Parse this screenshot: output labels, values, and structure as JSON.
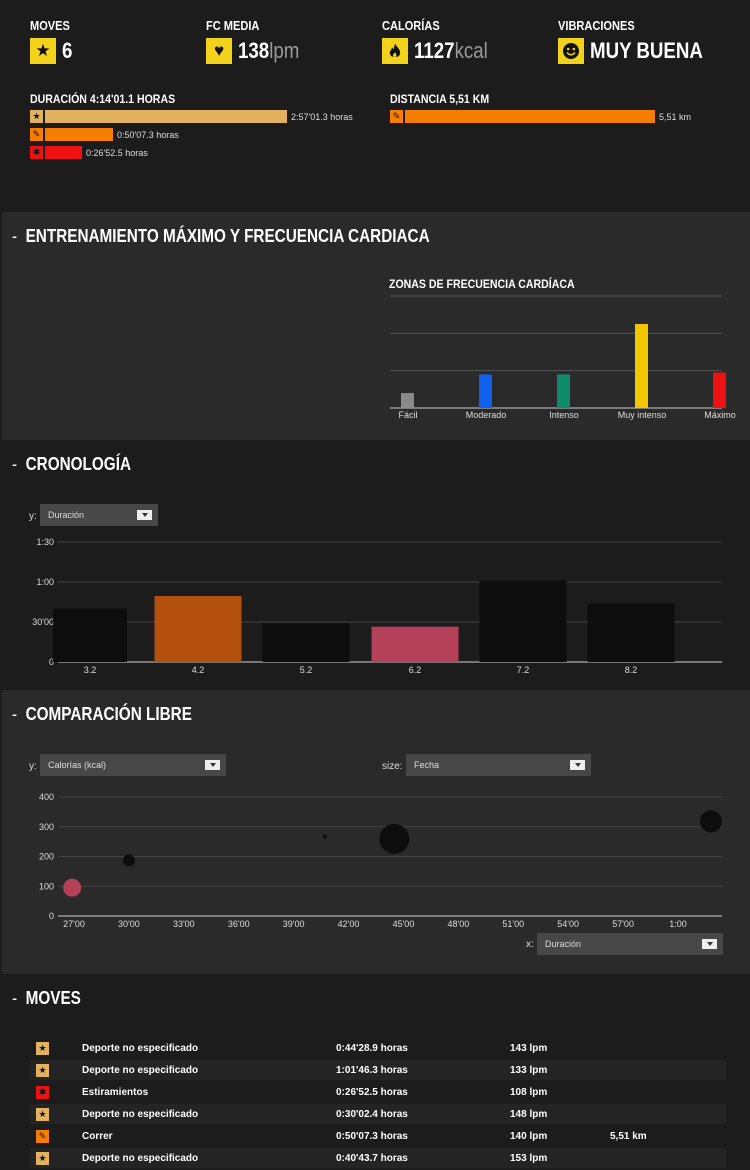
{
  "summary": {
    "moves": {
      "label": "MOVES",
      "value": "6",
      "icon": "star-icon"
    },
    "hr": {
      "label": "FC MEDIA",
      "value": "138",
      "unit": "lpm",
      "icon": "heart-icon"
    },
    "cal": {
      "label": "CALORÍAS",
      "value": "1127",
      "unit": "kcal",
      "icon": "flame-icon"
    },
    "mood": {
      "label": "VIBRACIONES",
      "value": "MUY BUENA",
      "icon": "smiley-icon"
    },
    "duration_label": "DURACIÓN 4:14'01.1 HORAS",
    "distance_label": "DISTANCIA 5,51 KM",
    "duration_bars": [
      {
        "icon": "star-icon",
        "color": "#e3b25e",
        "fraction": 1.0,
        "value": "2:57'01.3 horas"
      },
      {
        "icon": "running-icon",
        "color": "#f57d00",
        "fraction": 0.283,
        "value": "0:50'07.3 horas"
      },
      {
        "icon": "stretch-icon",
        "color": "#ee1111",
        "fraction": 0.152,
        "value": "0:26'52.5 horas"
      }
    ],
    "distance_bars": [
      {
        "icon": "running-icon",
        "color": "#f57d00",
        "fraction": 1.0,
        "value": "5,51 km"
      }
    ]
  },
  "training": {
    "title": "ENTRENAMIENTO MÁXIMO Y FRECUENCIA CARDIACA",
    "zones_title": "ZONAS DE FRECUENCIA CARDÍACA"
  },
  "chrono": {
    "title": "CRONOLOGÍA",
    "y_label": "y:",
    "y_select": "Duración"
  },
  "compare": {
    "title": "COMPARACIÓN LIBRE",
    "y_label": "y:",
    "y_select": "Calorías (kcal)",
    "size_label": "size:",
    "size_select": "Fecha",
    "x_label": "x:",
    "x_select": "Duración"
  },
  "moves": {
    "title": "MOVES",
    "rows": [
      {
        "icon": "star-icon",
        "color": "#e3b25e",
        "sport": "Deporte no especificado",
        "duration": "0:44'28.9 horas",
        "hr": "143 lpm",
        "distance": ""
      },
      {
        "icon": "star-icon",
        "color": "#e3b25e",
        "sport": "Deporte no especificado",
        "duration": "1:01'46.3 horas",
        "hr": "133 lpm",
        "distance": ""
      },
      {
        "icon": "stretch-icon",
        "color": "#ee1111",
        "sport": "Estiramientos",
        "duration": "0:26'52.5 horas",
        "hr": "108 lpm",
        "distance": ""
      },
      {
        "icon": "star-icon",
        "color": "#e3b25e",
        "sport": "Deporte no especificado",
        "duration": "0:30'02.4 horas",
        "hr": "148 lpm",
        "distance": ""
      },
      {
        "icon": "running-icon",
        "color": "#f57d00",
        "sport": "Correr",
        "duration": "0:50'07.3 horas",
        "hr": "140 lpm",
        "distance": "5,51 km"
      },
      {
        "icon": "star-icon",
        "color": "#e3b25e",
        "sport": "Deporte no especificado",
        "duration": "0:40'43.7 horas",
        "hr": "153 lpm",
        "distance": ""
      }
    ]
  },
  "chart_data": [
    {
      "type": "bar",
      "title": "ZONAS DE FRECUENCIA CARDÍACA",
      "categories": [
        "Fácil",
        "Moderado",
        "Intenso",
        "Muy intenso",
        "Máximo"
      ],
      "values": [
        4,
        9,
        9,
        22.5,
        9.5
      ],
      "colors": [
        "#8a8a8a",
        "#1060ee",
        "#0f8a6a",
        "#f2c600",
        "#ee1111"
      ],
      "ylim": [
        0,
        30
      ],
      "grid": true
    },
    {
      "type": "bar",
      "categories": [
        "3.2",
        "4.2",
        "5.2",
        "6.2",
        "7.2",
        "8.2"
      ],
      "values": [
        40,
        49.5,
        29,
        26.5,
        61,
        44
      ],
      "colors": [
        "#0d0d0d",
        "#b4500e",
        "#0d0d0d",
        "#b4405a",
        "#0d0d0d",
        "#0d0d0d"
      ],
      "yticks": [
        {
          "v": 0,
          "label": "0"
        },
        {
          "v": 30,
          "label": "30'00"
        },
        {
          "v": 60,
          "label": "1:00"
        },
        {
          "v": 90,
          "label": "1:30"
        }
      ],
      "ylim": [
        0,
        90
      ],
      "grid": true
    },
    {
      "type": "scatter",
      "xticks": [
        {
          "v": 27,
          "label": "27'00"
        },
        {
          "v": 30,
          "label": "30'00"
        },
        {
          "v": 33,
          "label": "33'00"
        },
        {
          "v": 36,
          "label": "36'00"
        },
        {
          "v": 39,
          "label": "39'00"
        },
        {
          "v": 42,
          "label": "42'00"
        },
        {
          "v": 45,
          "label": "45'00"
        },
        {
          "v": 48,
          "label": "48'00"
        },
        {
          "v": 51,
          "label": "51'00"
        },
        {
          "v": 54,
          "label": "54'00"
        },
        {
          "v": 57,
          "label": "57'00"
        },
        {
          "v": 60,
          "label": "1:00"
        }
      ],
      "yticks": [
        0,
        100,
        200,
        300,
        400
      ],
      "xlim": [
        27,
        60
      ],
      "ylim": [
        0,
        400
      ],
      "points": [
        {
          "x": 26.9,
          "y": 95,
          "size": 9,
          "color": "#b4405a"
        },
        {
          "x": 30.0,
          "y": 187,
          "size": 6,
          "color": "#0d0d0d"
        },
        {
          "x": 40.7,
          "y": 267,
          "size": 2,
          "color": "#0d0d0d"
        },
        {
          "x": 44.5,
          "y": 259,
          "size": 15,
          "color": "#0d0d0d"
        },
        {
          "x": 61.8,
          "y": 318,
          "size": 11,
          "color": "#0d0d0d"
        }
      ],
      "grid": true
    }
  ]
}
